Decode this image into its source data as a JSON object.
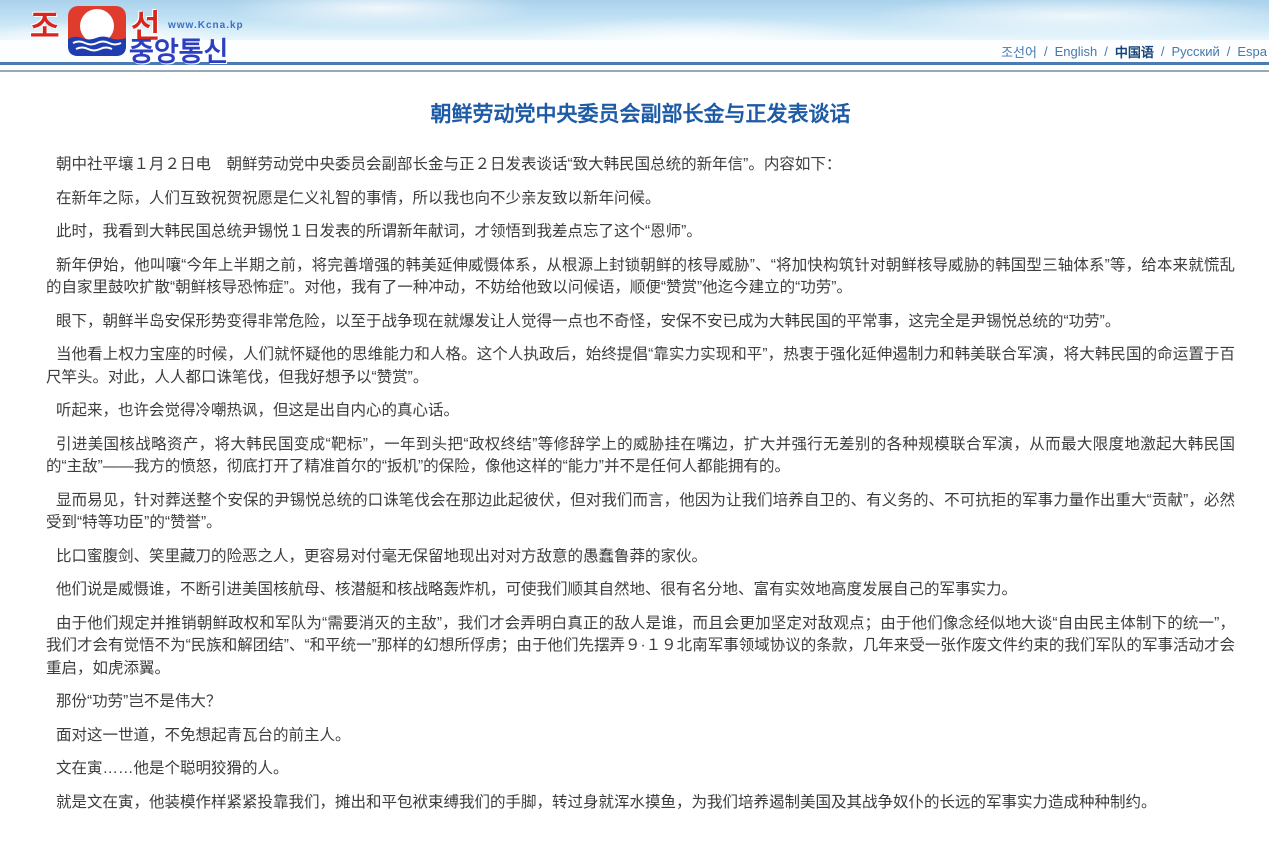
{
  "header": {
    "logo": {
      "left_char": "조",
      "right_char": "선",
      "url_text": "www.Kcna.kp",
      "title_text": "중앙통신",
      "emblem_red": "#e03c2d",
      "emblem_blue": "#1f3db0"
    },
    "separator": "/",
    "languages": [
      {
        "label": "조선어",
        "slug": "korean",
        "active": false
      },
      {
        "label": "English",
        "slug": "english",
        "active": false
      },
      {
        "label": "中国语",
        "slug": "chinese",
        "active": true
      },
      {
        "label": "Русский",
        "slug": "russian",
        "active": false
      },
      {
        "label": "Espa",
        "slug": "spanish",
        "active": false
      }
    ]
  },
  "article": {
    "title": "朝鲜劳动党中央委员会副部长金与正发表谈话",
    "paragraphs": [
      "朝中社平壤１月２日电　朝鲜劳动党中央委员会副部长金与正２日发表谈话“致大韩民国总统的新年信”。内容如下：",
      "在新年之际，人们互致祝贺祝愿是仁义礼智的事情，所以我也向不少亲友致以新年问候。",
      "此时，我看到大韩民国总统尹锡悦１日发表的所谓新年献词，才领悟到我差点忘了这个“恩师”。",
      "新年伊始，他叫嚷“今年上半期之前，将完善增强的韩美延伸威慑体系，从根源上封锁朝鲜的核导威胁”、“将加快构筑针对朝鲜核导威胁的韩国型三轴体系”等，给本来就慌乱的自家里鼓吹扩散“朝鲜核导恐怖症”。对他，我有了一种冲动，不妨给他致以问候语，顺便“赞赏”他迄今建立的“功劳”。",
      "眼下，朝鲜半岛安保形势变得非常危险，以至于战争现在就爆发让人觉得一点也不奇怪，安保不安已成为大韩民国的平常事，这完全是尹锡悦总统的“功劳”。",
      "当他看上权力宝座的时候，人们就怀疑他的思维能力和人格。这个人执政后，始终提倡“靠实力实现和平”，热衷于强化延伸遏制力和韩美联合军演，将大韩民国的命运置于百尺竿头。对此，人人都口诛笔伐，但我好想予以“赞赏”。",
      "听起来，也许会觉得冷嘲热讽，但这是出自内心的真心话。",
      "引进美国核战略资产，将大韩民国变成“靶标”，一年到头把“政权终结”等修辞学上的威胁挂在嘴边，扩大并强行无差别的各种规模联合军演，从而最大限度地激起大韩民国的“主敌”——我方的愤怒，彻底打开了精准首尔的“扳机”的保险，像他这样的“能力”并不是任何人都能拥有的。",
      "显而易见，针对葬送整个安保的尹锡悦总统的口诛笔伐会在那边此起彼伏，但对我们而言，他因为让我们培养自卫的、有义务的、不可抗拒的军事力量作出重大“贡献”，必然受到“特等功臣”的“赞誉”。",
      "比口蜜腹剑、笑里藏刀的险恶之人，更容易对付毫无保留地现出对对方敌意的愚蠢鲁莽的家伙。",
      "他们说是威慑谁，不断引进美国核航母、核潜艇和核战略轰炸机，可使我们顺其自然地、很有名分地、富有实效地高度发展自己的军事实力。",
      "由于他们规定并推销朝鲜政权和军队为“需要消灭的主敌”，我们才会弄明白真正的敌人是谁，而且会更加坚定对敌观点；由于他们像念经似地大谈“自由民主体制下的统一”，我们才会有觉悟不为“民族和解团结”、“和平统一”那样的幻想所俘虏；由于他们先摆弄９·１９北南军事领域协议的条款，几年来受一张作废文件约束的我们军队的军事活动才会重启，如虎添翼。",
      "那份“功劳”岂不是伟大？",
      "面对这一世道，不免想起青瓦台的前主人。",
      "文在寅……他是个聪明狡猾的人。",
      "就是文在寅，他装模作样紧紧投靠我们，摊出和平包袱束缚我们的手脚，转过身就浑水摸鱼，为我们培养遏制美国及其战争奴仆的长远的军事实力造成种种制约。"
    ]
  },
  "colors": {
    "title_blue": "#1e5ba6",
    "body_text": "#3d3d3d",
    "link_blue": "#4679ad",
    "active_link_blue": "#16457c",
    "rule_blue": "#4a7cb1",
    "sky_blue": "#aad2ec"
  }
}
